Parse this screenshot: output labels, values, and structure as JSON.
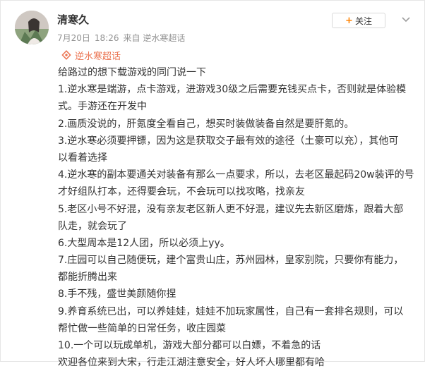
{
  "post": {
    "username": "清寒久",
    "date": "7月20日",
    "time": "18:26",
    "source": "来自 逆水寒超话",
    "follow_label": "关注",
    "topic_label": "逆水寒超话",
    "lines": [
      "给路过的想下载游戏的同门说一下",
      "1.逆水寒是端游，点卡游戏，进游戏30级之后需要充钱买点卡，否则就是体验模",
      "式。手游还在开发中",
      "2.画质没说的，肝氪度全看自己，想买时装做装备自然是要肝氪的。",
      "3.逆水寒必须要押镖，因为这是获取交子最有效的途径（土豪可以充），其他可",
      "以看着选择",
      "4.逆水寒的副本要通关对装备有那么一点要求，所以，去老区最起码20w装评的号",
      "才好组队打本，还得要会玩，不会玩可以找攻略，找亲友",
      "5.老区小号不好混，没有亲友老区新人更不好混，建议先去新区磨炼，跟着大部",
      "队走，就会玩了",
      "6.大型周本是12人团，所以必须上yy。",
      "7.庄园可以自己随便玩，建个富贵山庄，苏州园林，皇家别院，只要你有能力，",
      "都能折腾出来",
      "8.手不残，盛世美颜随你捏",
      "9.养育系统已出，可以养娃娃，娃娃不加玩家属性，自己有一套排名规则，可以",
      "帮忙做一些简单的日常任务，收庄园菜",
      "10.一个可以玩成单机，游戏大部分都可以白嫖，不着急的话",
      "欢迎各位来到大宋，行走江湖注意安全，好人坏人哪里都有哈"
    ]
  },
  "colors": {
    "accent": "#ff8200",
    "topic": "#eb7350",
    "meta": "#939393",
    "text": "#333333"
  },
  "icons": {
    "more": "chevron-down-icon",
    "topic": "super-topic-icon",
    "follow": "plus-icon"
  }
}
